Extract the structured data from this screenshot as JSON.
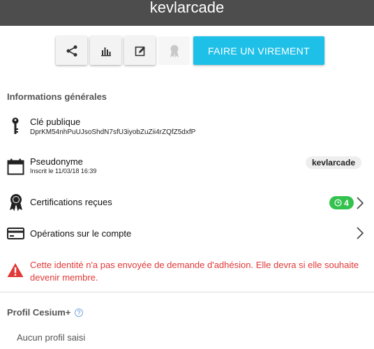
{
  "header": {
    "title": "kevlarcade"
  },
  "toolbar": {
    "share_icon": "share-icon",
    "stats_icon": "bar-chart-icon",
    "edit_icon": "edit-icon",
    "certify_icon": "certification-ribbon-icon",
    "transfer_label": "FAIRE UN VIREMENT",
    "accent_color": "#1fc0e8"
  },
  "general": {
    "title": "Informations générales",
    "pubkey": {
      "label": "Clé publique",
      "value": "DprKM54nhPuUJsoShdN7sfU3iyobZuZii4rZQfZ5dxfP"
    },
    "pseudo": {
      "label": "Pseudonyme",
      "sub": "Inscrit le 11/03/18 16:39",
      "badge": "kevlarcade"
    },
    "certifications": {
      "label": "Certifications reçues",
      "count": "4",
      "badge_color": "#33c24d"
    },
    "operations": {
      "label": "Opérations sur le compte"
    },
    "warning": {
      "text": "Cette identité n'a pas envoyée de demande d'adhésion. Elle devra si elle souhaite devenir membre.",
      "color": "#e23838"
    }
  },
  "cesium": {
    "title": "Profil Cesium+",
    "help": "?",
    "empty": "Aucun profil saisi"
  }
}
